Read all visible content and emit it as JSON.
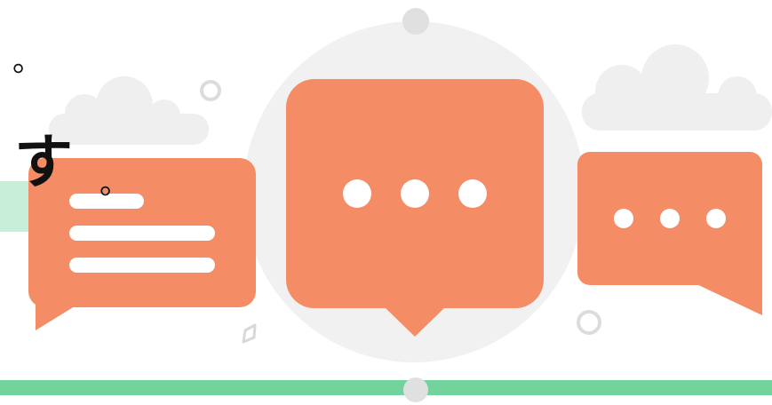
{
  "overlay": {
    "mark_top": "。",
    "kana": "す",
    "mark_bottom": "。"
  },
  "colors": {
    "bubble": "#F48C66",
    "accent_green": "#72D49C",
    "pale_green": "#C8EDD8",
    "backdrop_grey": "#F1F1F1",
    "cloud_grey": "#EEEEEE",
    "ring_grey": "#DCDCDC",
    "dot_white": "#FFFFFF"
  },
  "icons": [
    "speech-bubble-lines-icon",
    "speech-bubble-typing-icon",
    "speech-bubble-dots-icon",
    "cloud-icon",
    "ring-icon"
  ]
}
